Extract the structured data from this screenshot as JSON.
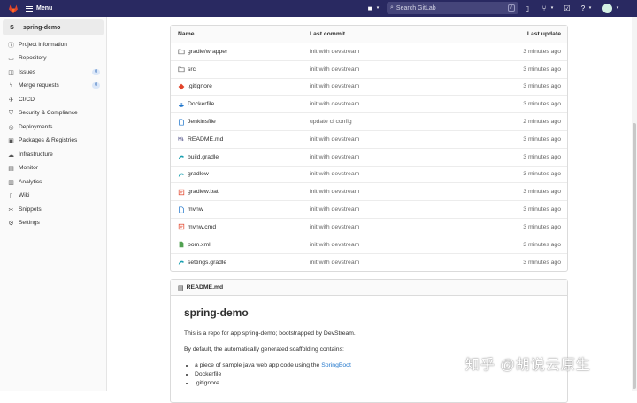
{
  "topbar": {
    "menu_label": "Menu",
    "search_placeholder": "Search GitLab",
    "search_shortcut": "/"
  },
  "sidebar": {
    "project_initial": "S",
    "project_name": "spring-demo",
    "items": [
      {
        "label": "Project information",
        "icon": "info-icon"
      },
      {
        "label": "Repository",
        "icon": "repository-icon"
      },
      {
        "label": "Issues",
        "icon": "issues-icon",
        "badge": "0"
      },
      {
        "label": "Merge requests",
        "icon": "merge-request-icon",
        "badge": "0"
      },
      {
        "label": "CI/CD",
        "icon": "rocket-icon"
      },
      {
        "label": "Security & Compliance",
        "icon": "shield-icon"
      },
      {
        "label": "Deployments",
        "icon": "deployments-icon"
      },
      {
        "label": "Packages & Registries",
        "icon": "package-icon"
      },
      {
        "label": "Infrastructure",
        "icon": "cloud-icon"
      },
      {
        "label": "Monitor",
        "icon": "monitor-icon"
      },
      {
        "label": "Analytics",
        "icon": "chart-icon"
      },
      {
        "label": "Wiki",
        "icon": "book-icon"
      },
      {
        "label": "Snippets",
        "icon": "scissors-icon"
      },
      {
        "label": "Settings",
        "icon": "gear-icon"
      }
    ]
  },
  "files": {
    "headers": {
      "name": "Name",
      "commit": "Last commit",
      "update": "Last update"
    },
    "rows": [
      {
        "name": "gradle/wrapper",
        "icon": "folder-icon",
        "commit": "init with devstream",
        "update": "3 minutes ago"
      },
      {
        "name": "src",
        "icon": "folder-icon",
        "commit": "init with devstream",
        "update": "3 minutes ago"
      },
      {
        "name": ".gitignore",
        "icon": "git-icon",
        "commit": "init with devstream",
        "update": "3 minutes ago"
      },
      {
        "name": "Dockerfile",
        "icon": "docker-icon",
        "commit": "init with devstream",
        "update": "3 minutes ago"
      },
      {
        "name": "Jenkinsfile",
        "icon": "file-icon",
        "commit": "update ci config",
        "update": "2 minutes ago"
      },
      {
        "name": "README.md",
        "icon": "markdown-icon",
        "commit": "init with devstream",
        "update": "3 minutes ago"
      },
      {
        "name": "build.gradle",
        "icon": "gradle-icon",
        "commit": "init with devstream",
        "update": "3 minutes ago"
      },
      {
        "name": "gradlew",
        "icon": "gradle-icon",
        "commit": "init with devstream",
        "update": "3 minutes ago"
      },
      {
        "name": "gradlew.bat",
        "icon": "script-icon",
        "commit": "init with devstream",
        "update": "3 minutes ago"
      },
      {
        "name": "mvnw",
        "icon": "file-icon",
        "commit": "init with devstream",
        "update": "3 minutes ago"
      },
      {
        "name": "mvnw.cmd",
        "icon": "script-icon",
        "commit": "init with devstream",
        "update": "3 minutes ago"
      },
      {
        "name": "pom.xml",
        "icon": "xml-icon",
        "commit": "init with devstream",
        "update": "3 minutes ago"
      },
      {
        "name": "settings.gradle",
        "icon": "gradle-icon",
        "commit": "init with devstream",
        "update": "3 minutes ago"
      }
    ]
  },
  "readme": {
    "header": "README.md",
    "title": "spring-demo",
    "para1": "This is a repo for app spring-demo; bootstrapped by DevStream.",
    "para2": "By default, the automatically generated scaffolding contains:",
    "list_item1_prefix": "a piece of sample java web app code using the ",
    "list_item1_link": "SpringBoot",
    "list_item2": "Dockerfile",
    "list_item3": ".gitignore"
  },
  "watermark": "知乎 @胡说云原生",
  "colors": {
    "topbar": "#292961",
    "link": "#1f75cb",
    "folder": "#666666",
    "docker": "#1f75cb",
    "gradle": "#1aa0b0",
    "script": "#e24329",
    "xml": "#52a152"
  }
}
